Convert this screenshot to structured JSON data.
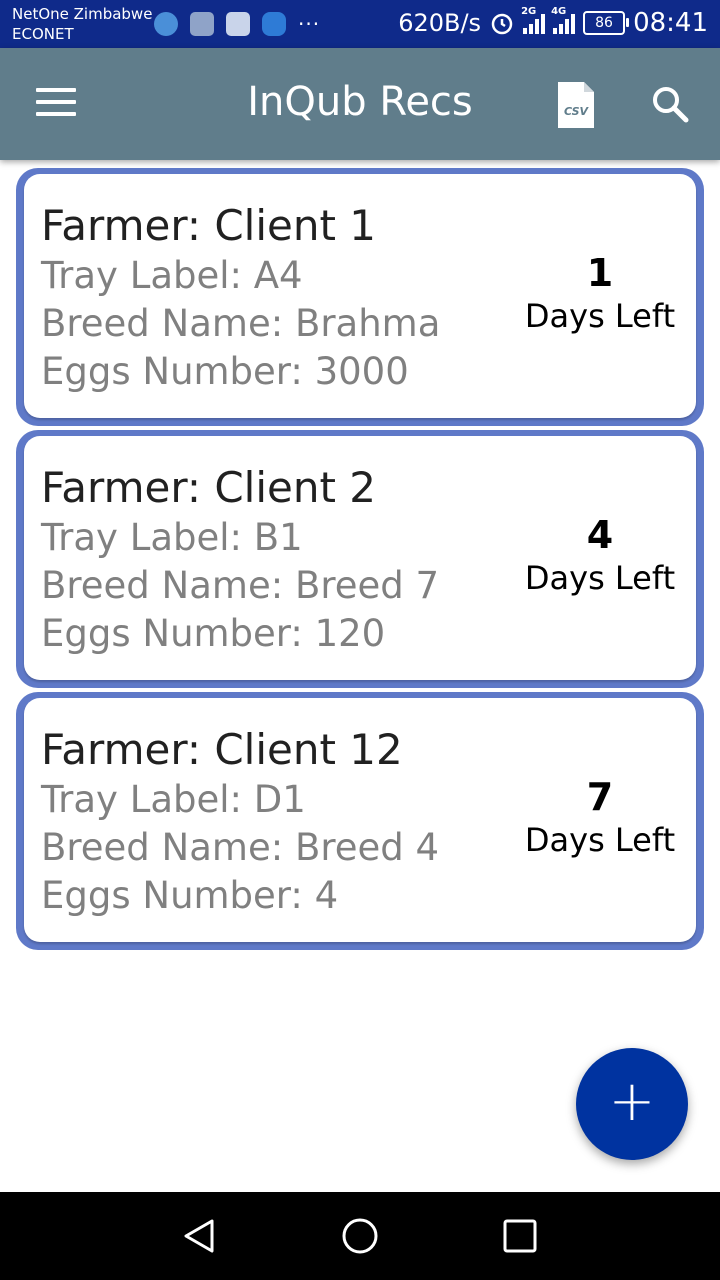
{
  "status_bar": {
    "carrier_line1": "NetOne Zimbabwe",
    "carrier_line2": "ECONET",
    "net_speed": "620B/s",
    "sim1_type": "2G",
    "sim2_type": "4G",
    "battery_level": "86",
    "time": "08:41",
    "overflow": "···"
  },
  "app_bar": {
    "title": "InQub Recs",
    "csv_icon_text": "CSV"
  },
  "records": [
    {
      "farmer": "Farmer: Client 1",
      "tray": "Tray Label: A4",
      "breed": "Breed Name: Brahma",
      "eggs": "Eggs Number: 3000",
      "days_value": "1",
      "days_label": "Days Left"
    },
    {
      "farmer": "Farmer: Client 2",
      "tray": "Tray Label: B1",
      "breed": "Breed Name: Breed 7",
      "eggs": "Eggs Number: 120",
      "days_value": "4",
      "days_label": "Days Left"
    },
    {
      "farmer": "Farmer: Client 12",
      "tray": "Tray Label: D1",
      "breed": "Breed Name: Breed 4",
      "eggs": "Eggs Number: 4",
      "days_value": "7",
      "days_label": "Days Left"
    }
  ],
  "fab": {
    "label": "+"
  },
  "colors": {
    "status_bar": "#0f2a8a",
    "app_bar": "#607d8b",
    "card_border": "#5f79c8",
    "fab": "#0033a0"
  }
}
